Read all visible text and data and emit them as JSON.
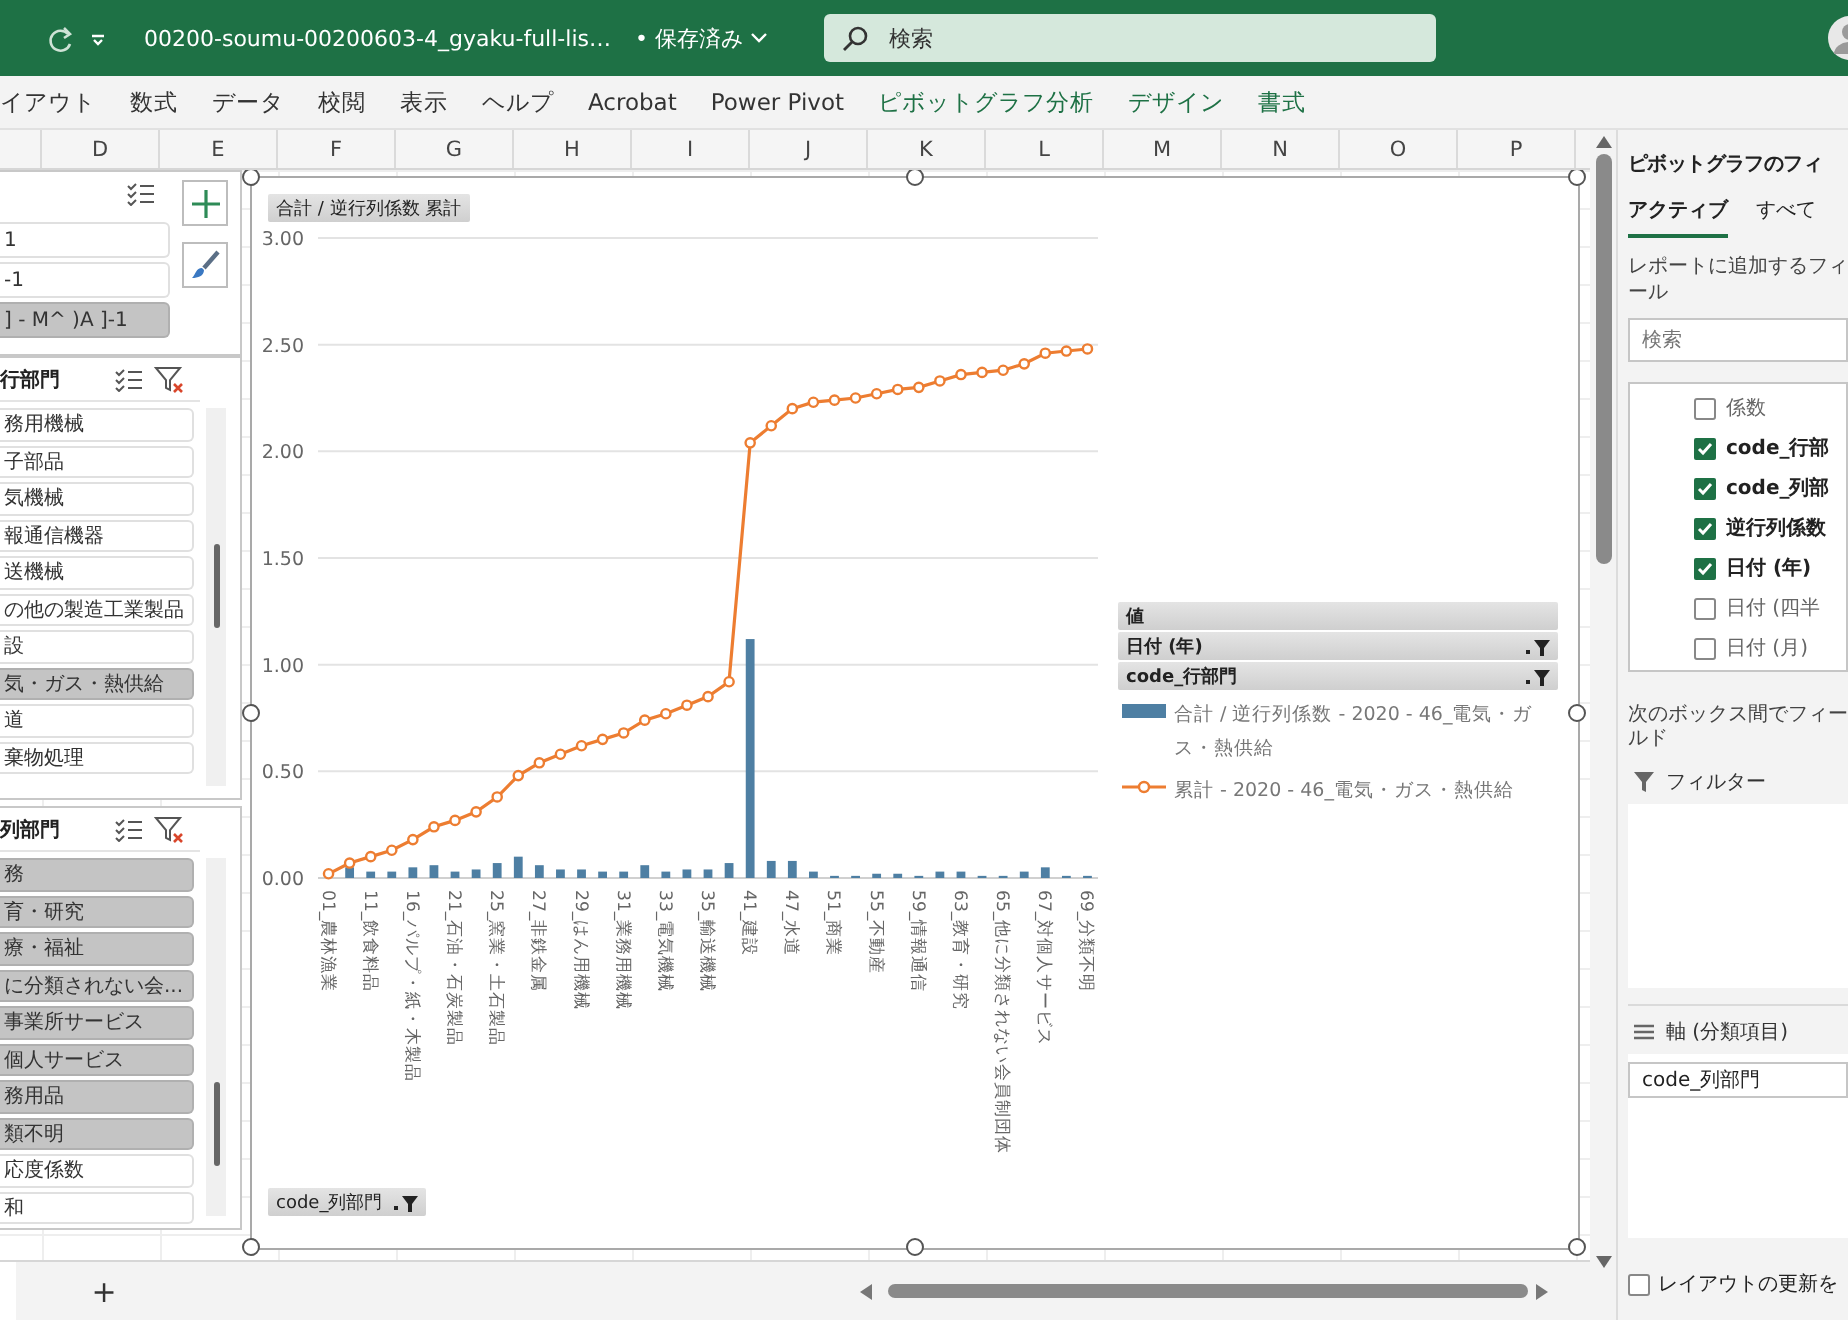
{
  "title_bar": {
    "file_name": "00200-soumu-00200603-4_gyaku-full-lis…",
    "save_status": "• 保存済み",
    "search_placeholder": "検索"
  },
  "ribbon_tabs": [
    {
      "label": "イアウト",
      "contextual": false
    },
    {
      "label": "数式",
      "contextual": false
    },
    {
      "label": "データ",
      "contextual": false
    },
    {
      "label": "校閲",
      "contextual": false
    },
    {
      "label": "表示",
      "contextual": false
    },
    {
      "label": "ヘルプ",
      "contextual": false
    },
    {
      "label": "Acrobat",
      "contextual": false
    },
    {
      "label": "Power Pivot",
      "contextual": false
    },
    {
      "label": "ピボットグラフ分析",
      "contextual": true
    },
    {
      "label": "デザイン",
      "contextual": true
    },
    {
      "label": "書式",
      "contextual": true
    }
  ],
  "column_headers": [
    "D",
    "E",
    "F",
    "G",
    "H",
    "I",
    "J",
    "K",
    "L",
    "M",
    "N",
    "O",
    "P"
  ],
  "slicers": [
    {
      "kind": "tools",
      "clear_filter": false,
      "items": [
        {
          "label": "1",
          "selected": false
        },
        {
          "label": "-1",
          "selected": false
        },
        {
          "label": "] - M^ )A ]-1",
          "selected": true
        }
      ]
    },
    {
      "kind": "scrolling",
      "header": "行部門",
      "clear_filter": true,
      "items": [
        {
          "label": "務用機械",
          "selected": false
        },
        {
          "label": "子部品",
          "selected": false
        },
        {
          "label": "気機械",
          "selected": false
        },
        {
          "label": "報通信機器",
          "selected": false
        },
        {
          "label": "送機械",
          "selected": false
        },
        {
          "label": "の他の製造工業製品",
          "selected": false
        },
        {
          "label": "設",
          "selected": false
        },
        {
          "label": "気・ガス・熱供給",
          "selected": true
        },
        {
          "label": "道",
          "selected": false
        },
        {
          "label": "棄物処理",
          "selected": false
        }
      ]
    },
    {
      "kind": "scrolling",
      "header": "列部門",
      "clear_filter": true,
      "items": [
        {
          "label": "務",
          "selected": true
        },
        {
          "label": "育・研究",
          "selected": true
        },
        {
          "label": "療・福祉",
          "selected": true
        },
        {
          "label": "に分類されない会...",
          "selected": true
        },
        {
          "label": "事業所サービス",
          "selected": true
        },
        {
          "label": "個人サービス",
          "selected": true
        },
        {
          "label": "務用品",
          "selected": true
        },
        {
          "label": "類不明",
          "selected": true
        },
        {
          "label": "応度係数",
          "selected": false
        },
        {
          "label": "和",
          "selected": false
        }
      ]
    }
  ],
  "chart": {
    "value_field_button": "合計 / 逆行列係数 累計",
    "axis_field_button": "code_列部門",
    "legend_fields": [
      {
        "label": "値",
        "has_filter": false
      },
      {
        "label": "日付 (年)",
        "has_filter": true
      },
      {
        "label": "code_行部門",
        "has_filter": true
      }
    ],
    "chart_data": {
      "type": "bar",
      "grid": true,
      "ylim": [
        0,
        3
      ],
      "yticks": [
        {
          "value": 0,
          "label": "0.00"
        },
        {
          "value": 0.5,
          "label": "0.50"
        },
        {
          "value": 1,
          "label": "1.00"
        },
        {
          "value": 1.5,
          "label": "1.50"
        },
        {
          "value": 2,
          "label": "2.00"
        },
        {
          "value": 2.5,
          "label": "2.50"
        },
        {
          "value": 3,
          "label": "3.00"
        }
      ],
      "categories": [
        "01_農林漁業",
        null,
        "11_飲食料品",
        null,
        "16_パルプ・紙・木製品",
        null,
        "21_石油・石炭製品",
        null,
        "25_窯業・土石製品",
        null,
        "27_非鉄金属",
        null,
        "29_はん用機械",
        null,
        "31_業務用機械",
        null,
        "33_電気機械",
        null,
        "35_輸送機械",
        null,
        "41_建設",
        null,
        "47_水道",
        null,
        "51_商業",
        null,
        "55_不動産",
        null,
        "59_情報通信",
        null,
        "63_教育・研究",
        null,
        "65_他に分類されない会員制団体",
        null,
        "67_対個人サービス",
        null,
        "69_分類不明"
      ],
      "series": [
        {
          "name": "合計 / 逆行列係数 - 2020 - 46_電気・ガス・熱供給",
          "color": "#4e7fa3",
          "values": [
            null,
            0.05,
            0.03,
            0.03,
            0.05,
            0.06,
            0.03,
            0.04,
            0.07,
            0.1,
            0.06,
            0.04,
            0.04,
            0.03,
            0.03,
            0.06,
            0.03,
            0.04,
            0.04,
            0.07,
            1.12,
            0.08,
            0.08,
            0.03,
            0.01,
            0.01,
            0.02,
            0.02,
            0.01,
            0.03,
            0.03,
            0.01,
            0.01,
            0.03,
            0.05,
            0.01,
            0.01
          ]
        },
        {
          "name": "累計 - 2020 - 46_電気・ガス・熱供給",
          "type": "line",
          "marker": true,
          "color": "#ed7d31",
          "values": [
            0.02,
            0.07,
            0.1,
            0.13,
            0.18,
            0.24,
            0.27,
            0.31,
            0.38,
            0.48,
            0.54,
            0.58,
            0.62,
            0.65,
            0.68,
            0.74,
            0.77,
            0.81,
            0.85,
            0.92,
            2.04,
            2.12,
            2.2,
            2.23,
            2.24,
            2.25,
            2.27,
            2.29,
            2.3,
            2.33,
            2.36,
            2.37,
            2.38,
            2.41,
            2.46,
            2.47,
            2.48
          ]
        }
      ]
    }
  },
  "field_pane": {
    "title": "ピボットグラフのフィ",
    "tabs": [
      {
        "label": "アクティブ",
        "selected": true
      },
      {
        "label": "すべて",
        "selected": false
      }
    ],
    "hint": "レポートに追加するフィール",
    "search_placeholder": "検索",
    "fields": [
      {
        "label": "係数",
        "checked": false
      },
      {
        "label": "code_行部",
        "checked": true
      },
      {
        "label": "code_列部",
        "checked": true
      },
      {
        "label": "逆行列係数",
        "checked": true
      },
      {
        "label": "日付 (年)",
        "checked": true
      },
      {
        "label": "日付 (四半",
        "checked": false
      },
      {
        "label": "日付 (月)",
        "checked": false
      }
    ],
    "areas_hint": "次のボックス間でフィールド",
    "filter_area": {
      "label": "フィルター"
    },
    "axis_area": {
      "label": "軸 (分類項目)",
      "items": [
        "code_列部門"
      ]
    },
    "defer_update": {
      "label": "レイアウトの更新を",
      "checked": false
    }
  },
  "sheet_bar": {
    "add_label": "+"
  }
}
